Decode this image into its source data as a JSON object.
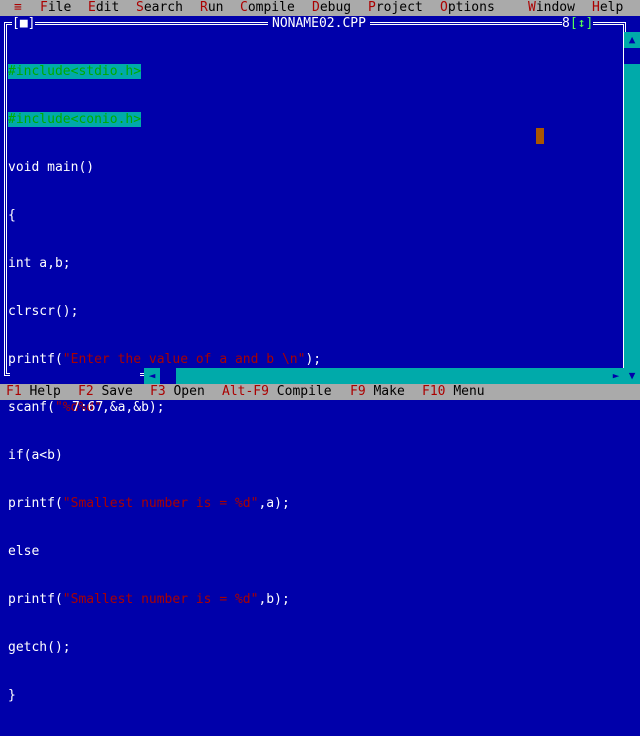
{
  "menubar": {
    "system_icon": "≡",
    "items": [
      {
        "hotkey": "F",
        "rest": "ile"
      },
      {
        "hotkey": "E",
        "rest": "dit"
      },
      {
        "hotkey": "S",
        "rest": "earch"
      },
      {
        "hotkey": "R",
        "rest": "un"
      },
      {
        "hotkey": "C",
        "rest": "ompile"
      },
      {
        "hotkey": "D",
        "rest": "ebug"
      },
      {
        "hotkey": "P",
        "rest": "roject"
      },
      {
        "hotkey": "O",
        "rest": "ptions"
      },
      {
        "hotkey": "W",
        "rest": "indow"
      },
      {
        "hotkey": "H",
        "rest": "elp"
      }
    ]
  },
  "window": {
    "title": "NONAME02.CPP",
    "close_box": "[■]",
    "number": "8",
    "zoom_box": "[↕]"
  },
  "code_lines": {
    "l1": "#include<stdio.h>",
    "l2": "#include<conio.h>",
    "l3": "void main()",
    "l4": "{",
    "l5": "int a,b;",
    "l6": "clrscr();",
    "l7a": "printf(",
    "l7b": "\"Enter the value of a and b \\n\"",
    "l7c": ");",
    "l8a": "scanf(",
    "l8b": "\"%d%d\"",
    "l8c": ",&a,&b);",
    "l9": "if(a<b)",
    "l10a": "printf(",
    "l10b": "\"Smallest number is = %d\"",
    "l10c": ",a);",
    "l11": "else",
    "l12a": "printf(",
    "l12b": "\"Smallest number is = %d\"",
    "l12c": ",b);",
    "l13": "getch();",
    "l14": "}"
  },
  "status": {
    "modified_mark": "*",
    "cursor_position": "7:67"
  },
  "statusbar": {
    "items": [
      {
        "key": "F1",
        "label": "Help"
      },
      {
        "key": "F2",
        "label": "Save"
      },
      {
        "key": "F3",
        "label": "Open"
      },
      {
        "key": "Alt-F9",
        "label": "Compile"
      },
      {
        "key": "F9",
        "label": "Make"
      },
      {
        "key": "F10",
        "label": "Menu"
      }
    ]
  },
  "colors": {
    "editor_background": "#0000aa",
    "menubar_background": "#aaaaaa",
    "hotkey": "#aa0000",
    "preprocessor_highlight": "#00aaaa",
    "identifier": "#ffff55",
    "string": "#aa0000",
    "cursor": "#aa5500",
    "scrollbar": "#00aaaa"
  }
}
